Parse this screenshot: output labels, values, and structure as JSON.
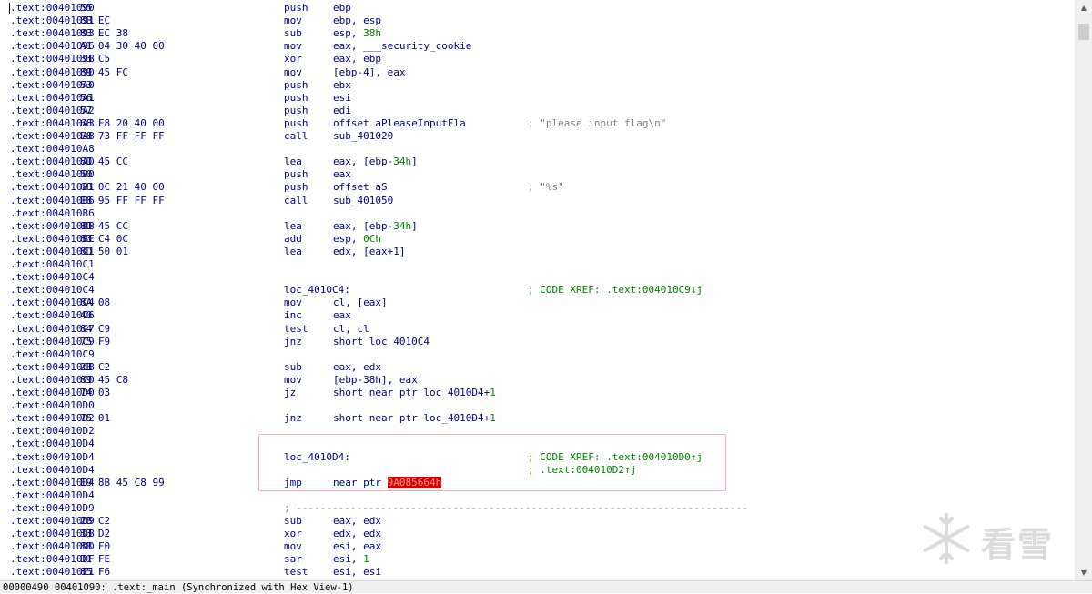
{
  "status_text": "00000490 00401090: .text:_main (Synchronized with Hex View-1)",
  "watermark_text": "看雪",
  "lines": [
    {
      "addr": ".text:00401090",
      "bytes": "55",
      "mn": "push",
      "op": "ebp"
    },
    {
      "addr": ".text:00401091",
      "bytes": "8B EC",
      "mn": "mov",
      "op": "ebp, esp"
    },
    {
      "addr": ".text:00401093",
      "bytes": "83 EC 38",
      "mn": "sub",
      "op": "esp, ",
      "num": "38h"
    },
    {
      "addr": ".text:00401096",
      "bytes": "A1 04 30 40 00",
      "mn": "mov",
      "op": "eax, ___security_cookie"
    },
    {
      "addr": ".text:0040109B",
      "bytes": "33 C5",
      "mn": "xor",
      "op": "eax, ebp"
    },
    {
      "addr": ".text:0040109D",
      "bytes": "89 45 FC",
      "mn": "mov",
      "op": "[ebp-4], eax"
    },
    {
      "addr": ".text:004010A0",
      "bytes": "53",
      "mn": "push",
      "op": "ebx"
    },
    {
      "addr": ".text:004010A1",
      "bytes": "56",
      "mn": "push",
      "op": "esi"
    },
    {
      "addr": ".text:004010A2",
      "bytes": "57",
      "mn": "push",
      "op": "edi"
    },
    {
      "addr": ".text:004010A3",
      "bytes": "68 F8 20 40 00",
      "mn": "push",
      "op": "offset aPleaseInputFla",
      "cmt": "; \"please input flag\\n\""
    },
    {
      "addr": ".text:004010A8",
      "bytes": "E8 73 FF FF FF",
      "mn": "call",
      "op": "sub_401020"
    },
    {
      "addr": ".text:004010A8"
    },
    {
      "addr": ".text:004010AD",
      "bytes": "8D 45 CC",
      "mn": "lea",
      "op": "eax, [ebp-",
      "num": "34h",
      "op2": "]"
    },
    {
      "addr": ".text:004010B0",
      "bytes": "50",
      "mn": "push",
      "op": "eax"
    },
    {
      "addr": ".text:004010B1",
      "bytes": "68 0C 21 40 00",
      "mn": "push",
      "op": "offset aS",
      "cmt": "; \"%s\""
    },
    {
      "addr": ".text:004010B6",
      "bytes": "E8 95 FF FF FF",
      "mn": "call",
      "op": "sub_401050"
    },
    {
      "addr": ".text:004010B6"
    },
    {
      "addr": ".text:004010BB",
      "bytes": "8D 45 CC",
      "mn": "lea",
      "op": "eax, [ebp-",
      "num": "34h",
      "op2": "]"
    },
    {
      "addr": ".text:004010BE",
      "bytes": "83 C4 0C",
      "mn": "add",
      "op": "esp, ",
      "num": "0Ch"
    },
    {
      "addr": ".text:004010C1",
      "bytes": "8D 50 01",
      "mn": "lea",
      "op": "edx, [eax+1]"
    },
    {
      "addr": ".text:004010C1"
    },
    {
      "addr": ".text:004010C4"
    },
    {
      "addr": ".text:004010C4",
      "label": "loc_4010C4:",
      "xref": "; CODE XREF: .text:004010C9↓j"
    },
    {
      "addr": ".text:004010C4",
      "bytes": "8A 08",
      "mn": "mov",
      "op": "cl, [eax]"
    },
    {
      "addr": ".text:004010C6",
      "bytes": "40",
      "mn": "inc",
      "op": "eax"
    },
    {
      "addr": ".text:004010C7",
      "bytes": "84 C9",
      "mn": "test",
      "op": "cl, cl"
    },
    {
      "addr": ".text:004010C9",
      "bytes": "75 F9",
      "mn": "jnz",
      "op": "short loc_4010C4"
    },
    {
      "addr": ".text:004010C9"
    },
    {
      "addr": ".text:004010CB",
      "bytes": "2B C2",
      "mn": "sub",
      "op": "eax, edx"
    },
    {
      "addr": ".text:004010CD",
      "bytes": "89 45 C8",
      "mn": "mov",
      "op": "[ebp-38h], eax"
    },
    {
      "addr": ".text:004010D0",
      "bytes": "74 03",
      "mn": "jz",
      "op": "short near ptr loc_4010D4+",
      "num": "1"
    },
    {
      "addr": ".text:004010D0"
    },
    {
      "addr": ".text:004010D2",
      "bytes": "75 01",
      "mn": "jnz",
      "op": "short near ptr loc_4010D4+",
      "num": "1"
    },
    {
      "addr": ".text:004010D2"
    },
    {
      "addr": ".text:004010D4"
    },
    {
      "addr": ".text:004010D4",
      "label": "loc_4010D4:",
      "xref": "; CODE XREF: .text:004010D0↑j"
    },
    {
      "addr": ".text:004010D4",
      "xref": "; .text:004010D2↑j"
    },
    {
      "addr": ".text:004010D4",
      "bytes": "E9 8B 45 C8 99",
      "mn": "jmp",
      "op": "near ptr ",
      "hl": "9A085664h"
    },
    {
      "addr": ".text:004010D4"
    },
    {
      "addr": ".text:004010D9",
      "sep": "; ---------------------------------------------------------------------------"
    },
    {
      "addr": ".text:004010D9",
      "bytes": "2B C2",
      "mn": "sub",
      "op": "eax, edx"
    },
    {
      "addr": ".text:004010DB",
      "bytes": "33 D2",
      "mn": "xor",
      "op": "edx, edx"
    },
    {
      "addr": ".text:004010DD",
      "bytes": "8B F0",
      "mn": "mov",
      "op": "esi, eax"
    },
    {
      "addr": ".text:004010DF",
      "bytes": "D1 FE",
      "mn": "sar",
      "op": "esi, ",
      "num": "1"
    },
    {
      "addr": ".text:004010E1",
      "bytes": "85 F6",
      "mn": "test",
      "op": "esi, esi"
    }
  ]
}
